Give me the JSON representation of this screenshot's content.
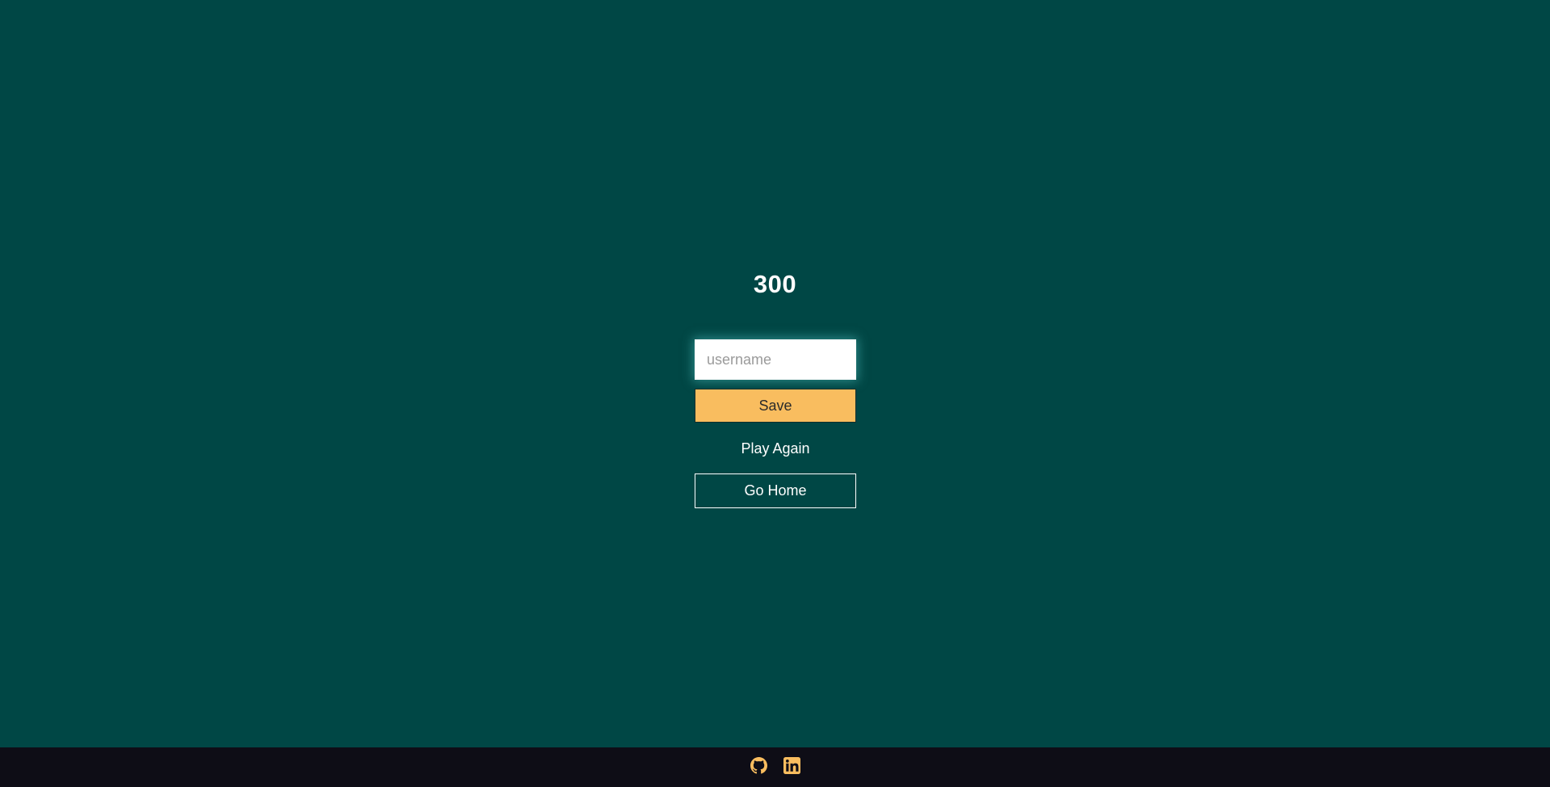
{
  "score": {
    "value": "300"
  },
  "form": {
    "username_placeholder": "username",
    "username_value": "",
    "save_label": "Save",
    "play_again_label": "Play Again",
    "go_home_label": "Go Home"
  },
  "footer": {
    "icons": [
      "github-icon",
      "linkedin-icon"
    ]
  },
  "colors": {
    "background": "#004745",
    "accent": "#f9bd5f",
    "footer_bg": "#0e0d16",
    "text": "#ffffff"
  }
}
